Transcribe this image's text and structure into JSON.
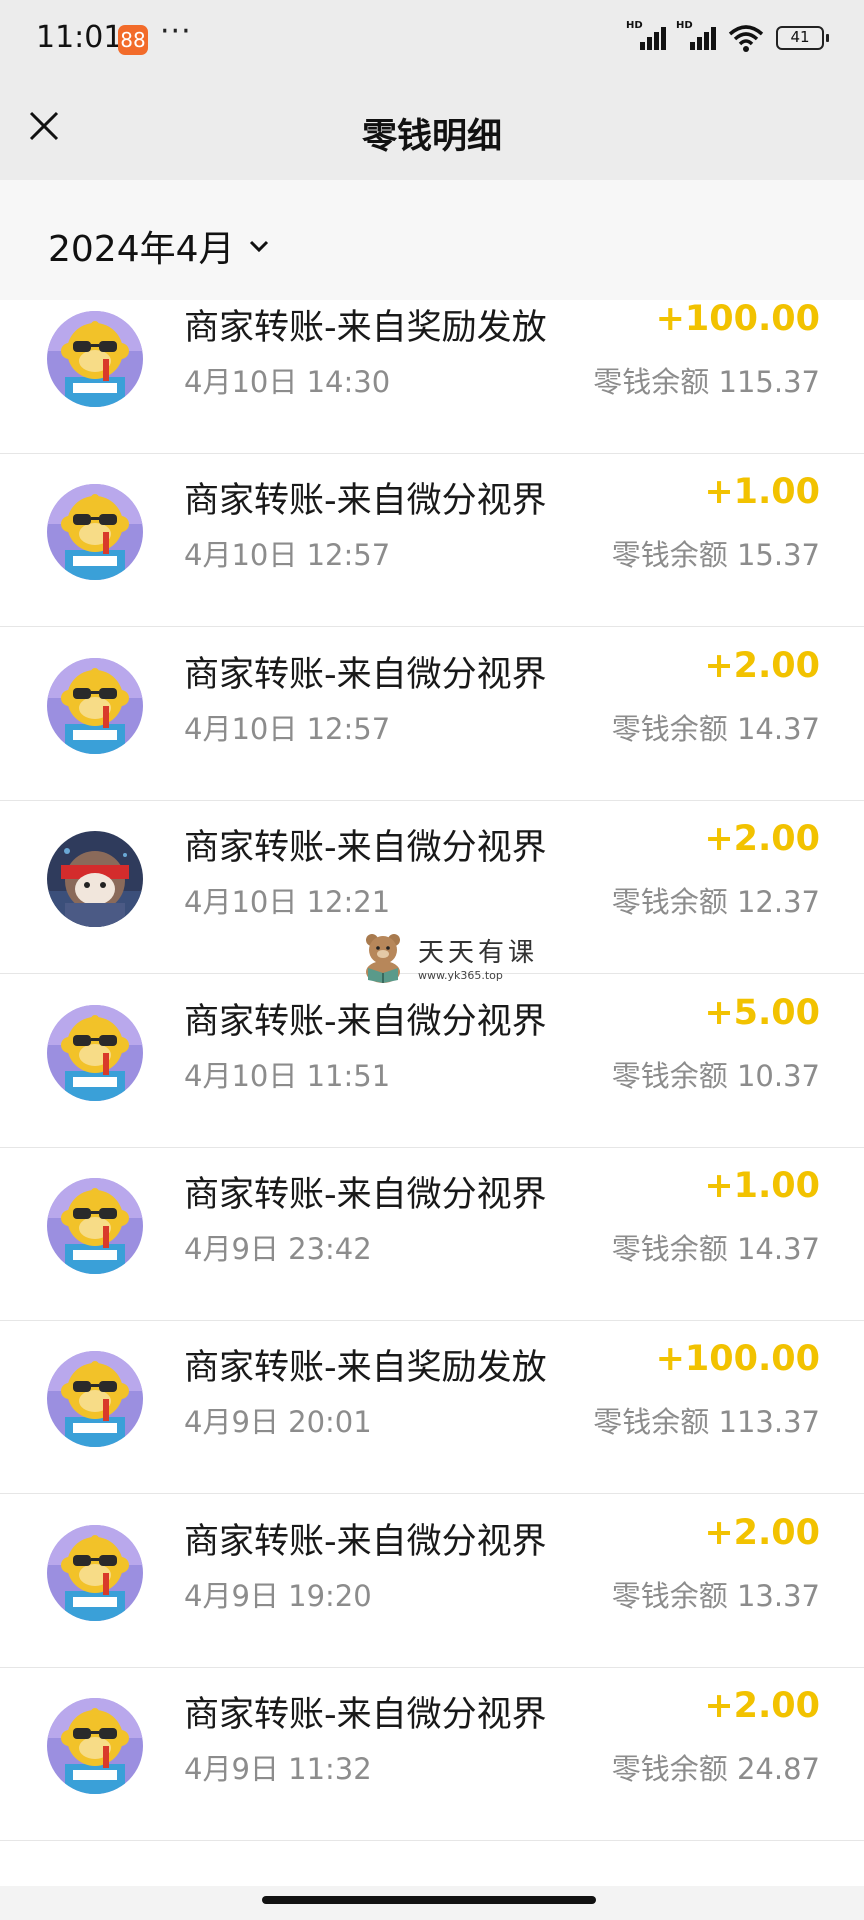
{
  "status_bar": {
    "time": "11:01",
    "app_badge": "88",
    "dots": "···",
    "signal_label": "HD",
    "battery": "41"
  },
  "header": {
    "title": "零钱明细"
  },
  "month_filter": {
    "label": "2024年4月"
  },
  "transactions": [
    {
      "title": "商家转账-来自奖励发放",
      "date": "4月10日 14:30",
      "amount": "+100.00",
      "balance": "零钱余额 115.37",
      "avatar": "monkey"
    },
    {
      "title": "商家转账-来自微分视界",
      "date": "4月10日 12:57",
      "amount": "+1.00",
      "balance": "零钱余额 15.37",
      "avatar": "monkey"
    },
    {
      "title": "商家转账-来自微分视界",
      "date": "4月10日 12:57",
      "amount": "+2.00",
      "balance": "零钱余额 14.37",
      "avatar": "monkey"
    },
    {
      "title": "商家转账-来自微分视界",
      "date": "4月10日 12:21",
      "amount": "+2.00",
      "balance": "零钱余额 12.37",
      "avatar": "ninja"
    },
    {
      "title": "商家转账-来自微分视界",
      "date": "4月10日 11:51",
      "amount": "+5.00",
      "balance": "零钱余额 10.37",
      "avatar": "monkey"
    },
    {
      "title": "商家转账-来自微分视界",
      "date": "4月9日 23:42",
      "amount": "+1.00",
      "balance": "零钱余额 14.37",
      "avatar": "monkey"
    },
    {
      "title": "商家转账-来自奖励发放",
      "date": "4月9日 20:01",
      "amount": "+100.00",
      "balance": "零钱余额 113.37",
      "avatar": "monkey"
    },
    {
      "title": "商家转账-来自微分视界",
      "date": "4月9日 19:20",
      "amount": "+2.00",
      "balance": "零钱余额 13.37",
      "avatar": "monkey"
    },
    {
      "title": "商家转账-来自微分视界",
      "date": "4月9日 11:32",
      "amount": "+2.00",
      "balance": "零钱余额 24.87",
      "avatar": "monkey"
    }
  ],
  "watermark": {
    "name": "天天有课",
    "url": "www.yk365.top"
  },
  "colors": {
    "amount": "#f2c200",
    "header_bg": "#ececec",
    "month_bg": "#f7f7f7",
    "secondary_text": "#8c8c8c"
  }
}
